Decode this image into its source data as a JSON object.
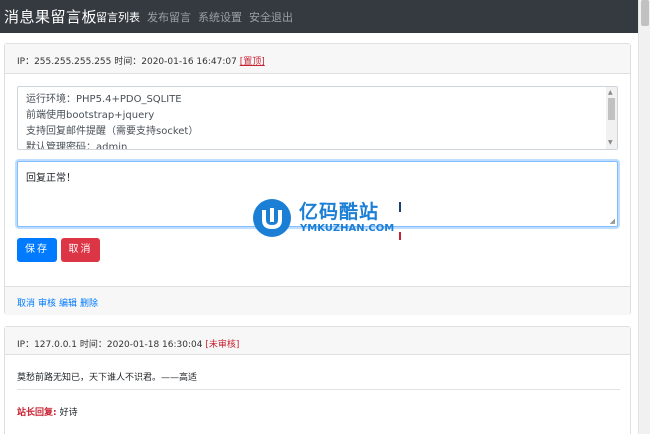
{
  "navbar": {
    "brand": "消息果留言板",
    "items": [
      {
        "label": "留言列表",
        "active": true
      },
      {
        "label": "发布留言",
        "active": false
      },
      {
        "label": "系统设置",
        "active": false
      },
      {
        "label": "安全退出",
        "active": false
      }
    ]
  },
  "messages": [
    {
      "ip_label": "IP：255.255.255.255 时间：2020-01-16 16:47:07",
      "status_tag": "[置顶]",
      "content_lines": [
        "运行环境：PHP5.4+PDO_SQLITE",
        "前端使用bootstrap+jquery",
        "支持回复邮件提醒（需要支持socket）",
        "默认管理密码：admin"
      ],
      "reply_value": "回复正常！",
      "save_label": "保存",
      "cancel_label": "取消",
      "actions": [
        "取消",
        "审核",
        "编辑",
        "删除"
      ]
    },
    {
      "ip_label": "IP：127.0.0.1 时间：2020-01-18 16:30:04",
      "status_tag": "[未审核]",
      "content": "莫愁前路无知已，天下谁人不识君。——高适",
      "reply_label": "站长回复:",
      "reply": "好诗"
    }
  ],
  "watermark": {
    "title": "亿码酷站",
    "subtitle": "YMKUZHAN.COM",
    "color": "#1c7fd6"
  },
  "colors": {
    "navbar": "#343a40",
    "primary": "#007bff",
    "danger": "#dc3545",
    "tag": "#c82333"
  }
}
